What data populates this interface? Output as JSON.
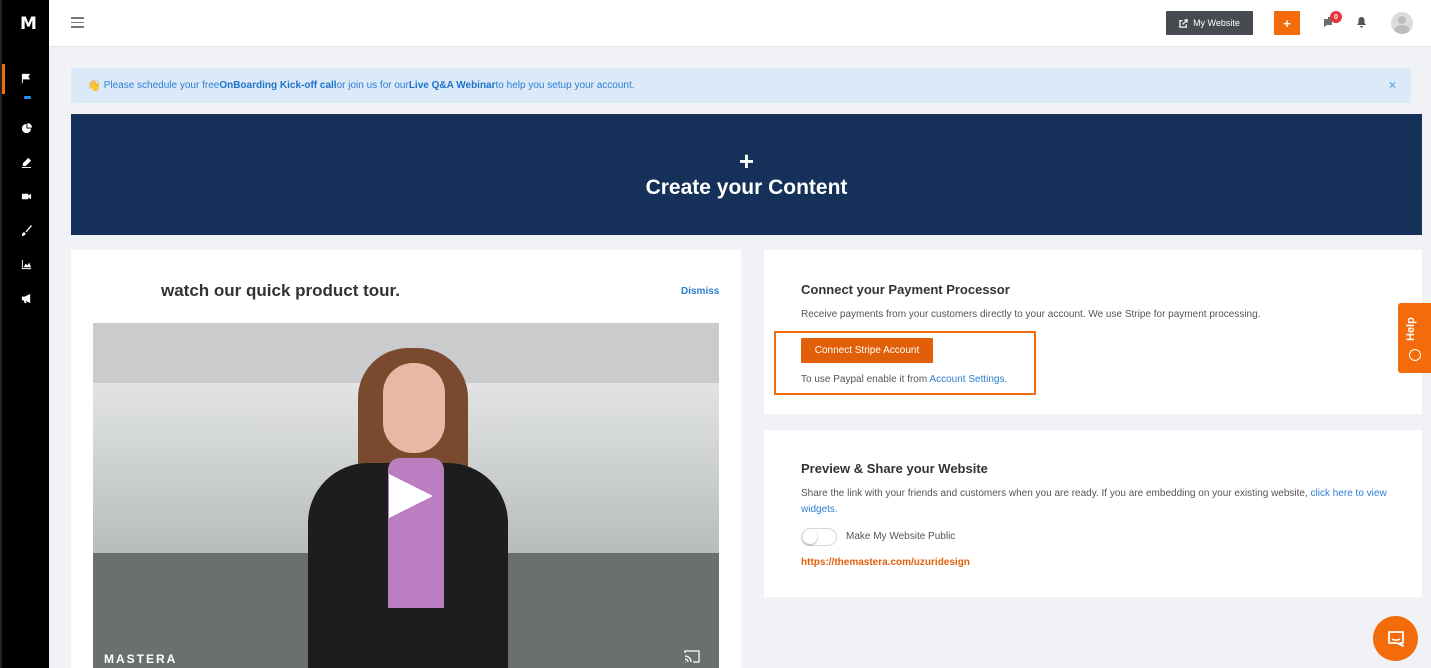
{
  "app": {
    "logo": "M"
  },
  "sidebar": {
    "items": [
      {
        "icon": "flag-icon"
      },
      {
        "icon": "pie-chart-icon"
      },
      {
        "icon": "pen-icon"
      },
      {
        "icon": "video-icon"
      },
      {
        "icon": "brush-icon"
      },
      {
        "icon": "area-chart-icon"
      },
      {
        "icon": "megaphone-icon"
      }
    ]
  },
  "topbar": {
    "my_website_label": "My Website",
    "add_label": "+",
    "chat_badge_count": "0"
  },
  "notice": {
    "prefix": "Please schedule your free ",
    "link1": "OnBoarding Kick-off call",
    "middle": " or join us for our ",
    "link2": "Live Q&A Webinar",
    "suffix": " to help you setup your account.",
    "close": "×"
  },
  "hero": {
    "plus": "+",
    "title": "Create your Content"
  },
  "tour": {
    "title": "watch our quick product tour.",
    "dismiss": "Dismiss",
    "video_logo": "MASTERA"
  },
  "payment": {
    "title": "Connect your Payment Processor",
    "description": "Receive payments from your customers directly to your account. We use Stripe for payment processing.",
    "connect_button": "Connect Stripe Account",
    "paypal_prefix": "To use Paypal enable it from ",
    "paypal_link": "Account Settings."
  },
  "preview": {
    "title": "Preview & Share your Website",
    "description": "Share the link with your friends and customers when you are ready. If you are embedding on your existing website, ",
    "description_link": "click here to view widgets.",
    "toggle_label": "Make My Website Public",
    "url": "https://themastera.com/uzuridesign"
  },
  "help": {
    "label": "Help"
  },
  "colors": {
    "accent": "#f36b0a",
    "hero": "#163159",
    "link": "#2d7fd3"
  }
}
